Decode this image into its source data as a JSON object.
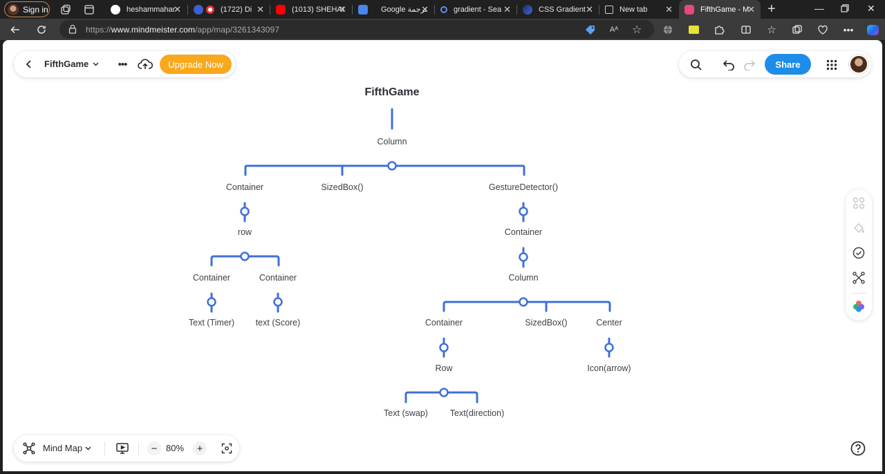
{
  "browser": {
    "profile": {
      "label": "Sign in"
    },
    "tabs": [
      {
        "title": "heshammahar",
        "icon": "github-icon"
      },
      {
        "title": "(1722) Di",
        "icon": "record-icon"
      },
      {
        "title": "(1013) SHEHAI",
        "icon": "youtube-icon"
      },
      {
        "title": "Google ترجمة",
        "icon": "translate-icon"
      },
      {
        "title": "gradient - Sea",
        "icon": "search-icon"
      },
      {
        "title": "CSS Gradient",
        "icon": "css-gradient-icon"
      },
      {
        "title": "New tab",
        "icon": "page-icon"
      },
      {
        "title": "FifthGame - M",
        "icon": "mindmeister-icon",
        "active": true
      }
    ],
    "url": {
      "prefix": "https://",
      "host": "www.mindmeister.com",
      "path": "/app/map/3261343097"
    }
  },
  "toolbar": {
    "map_title": "FifthGame",
    "upgrade_label": "Upgrade Now",
    "share_label": "Share"
  },
  "bottom_bar": {
    "mode_label": "Mind Map",
    "zoom_label": "80%"
  },
  "mindmap": {
    "root": "FifthGame",
    "column": "Column",
    "container_left": "Container",
    "sizedbox_top": "SizedBox()",
    "gesture": "GestureDetector()",
    "row_left": "row",
    "container_timer": "Container",
    "container_score": "Container",
    "text_timer": "Text (Timer)",
    "text_score": "text (Score)",
    "container_right": "Container",
    "column_right": "Column",
    "container_row": "Container",
    "sizedbox_right": "SizedBox()",
    "center": "Center",
    "row_right": "Row",
    "icon_arrow": "Icon(arrow)",
    "text_swap": "Text (swap)",
    "text_direction": "Text(direction)"
  },
  "colors": {
    "branch": "#3f6fd8",
    "accent_upgrade": "#f8a81d",
    "accent_share": "#1d8dea"
  }
}
